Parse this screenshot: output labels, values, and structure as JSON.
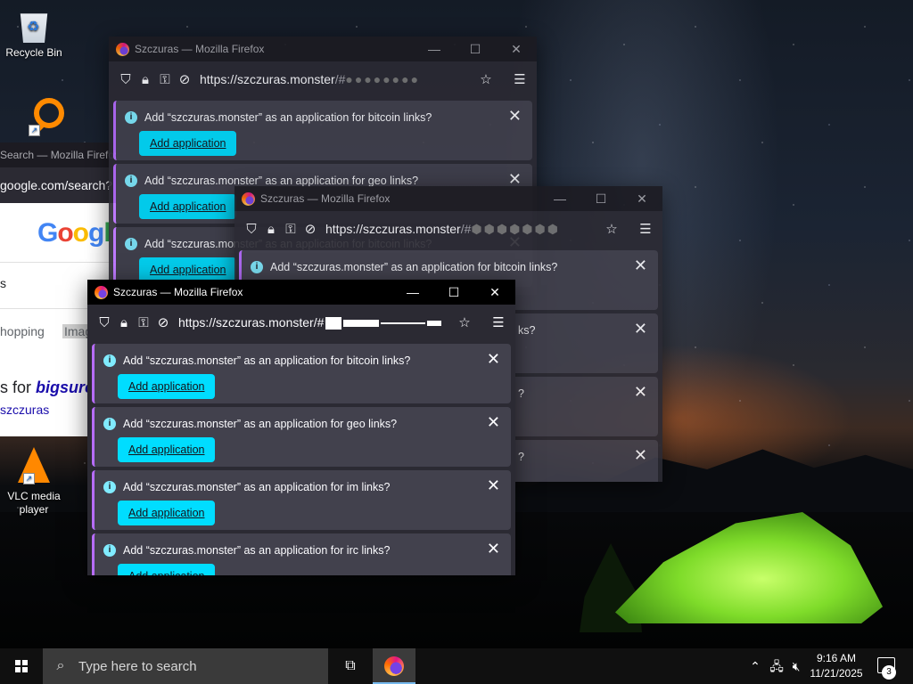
{
  "desktop": {
    "icons": [
      {
        "label": "Recycle Bin"
      },
      {
        "label": ""
      },
      {
        "label": "VLC media player"
      }
    ]
  },
  "google_window": {
    "title": "Search — Mozilla Firefox",
    "url": "google.com/search?",
    "logo": "Google",
    "tab_text": "s",
    "nav": [
      "hopping",
      "Imag"
    ],
    "result_prefix": "s for ",
    "result_query": "bigsurc",
    "result_sub": "szczuras"
  },
  "window_back": {
    "title": "Szczuras — Mozilla Firefox",
    "url_host": "https://szczuras.monster",
    "url_rest": "/#",
    "notices": [
      {
        "message": "Add “szczuras.monster” as an application for bitcoin links?",
        "button": "Add application"
      },
      {
        "message": "Add “szczuras.monster” as an application for geo links?",
        "button": "Add application"
      },
      {
        "message": "Add “szczuras.monster” as an application for bitcoin links?",
        "button": "Add application"
      }
    ]
  },
  "window_mid": {
    "title": "Szczuras — Mozilla Firefox",
    "url_host": "https://szczuras.monster",
    "url_rest": "/#",
    "notices": [
      {
        "message": "Add “szczuras.monster” as an application for bitcoin links?",
        "tail": ""
      },
      {
        "message": "",
        "tail": "ks?"
      },
      {
        "message": "",
        "tail": "?"
      },
      {
        "message": "",
        "tail": "?"
      }
    ]
  },
  "window_front": {
    "title": "Szczuras — Mozilla Firefox",
    "url_host": "https://szczuras.monster",
    "url_rest": "/#",
    "notices": [
      {
        "message": "Add “szczuras.monster” as an application for bitcoin links?",
        "button": "Add application"
      },
      {
        "message": "Add “szczuras.monster” as an application for geo links?",
        "button": "Add application"
      },
      {
        "message": "Add “szczuras.monster” as an application for im links?",
        "button": "Add application"
      },
      {
        "message": "Add “szczuras.monster” as an application for irc links?",
        "button": "Add application"
      }
    ]
  },
  "taskbar": {
    "search_placeholder": "Type here to search",
    "time": "9:16 AM",
    "date": "11/21/2025",
    "notification_count": "3"
  },
  "colors": {
    "accent_button": "#00ddff",
    "notice_bar": "#42414d",
    "window_bg": "#2b2a33"
  }
}
